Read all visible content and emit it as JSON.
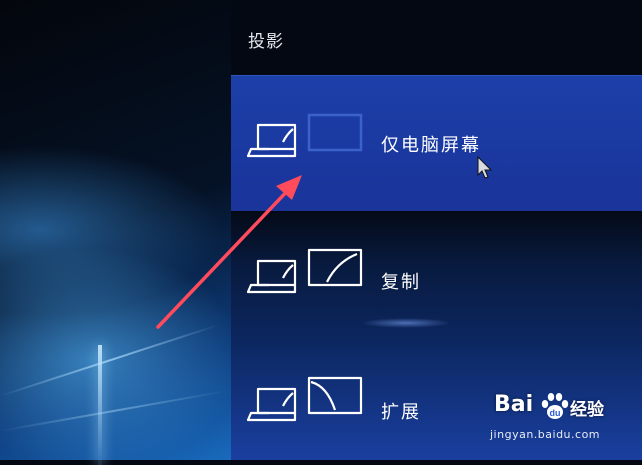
{
  "panel": {
    "title": "投影"
  },
  "options": [
    {
      "label": "仅电脑屏幕",
      "icon": "pc-screen-only-icon",
      "selected": true
    },
    {
      "label": "复制",
      "icon": "duplicate-icon",
      "selected": false
    },
    {
      "label": "扩展",
      "icon": "extend-icon",
      "selected": false
    }
  ],
  "watermark": {
    "brand": "Bai",
    "brand_suffix": "经验",
    "url": "jingyan.baidu.com"
  },
  "colors": {
    "selected_bg": "#1d3fa8",
    "panel_bg": "#040813",
    "annotation_arrow": "#ff4b5c",
    "icon_stroke": "#ffffff"
  }
}
